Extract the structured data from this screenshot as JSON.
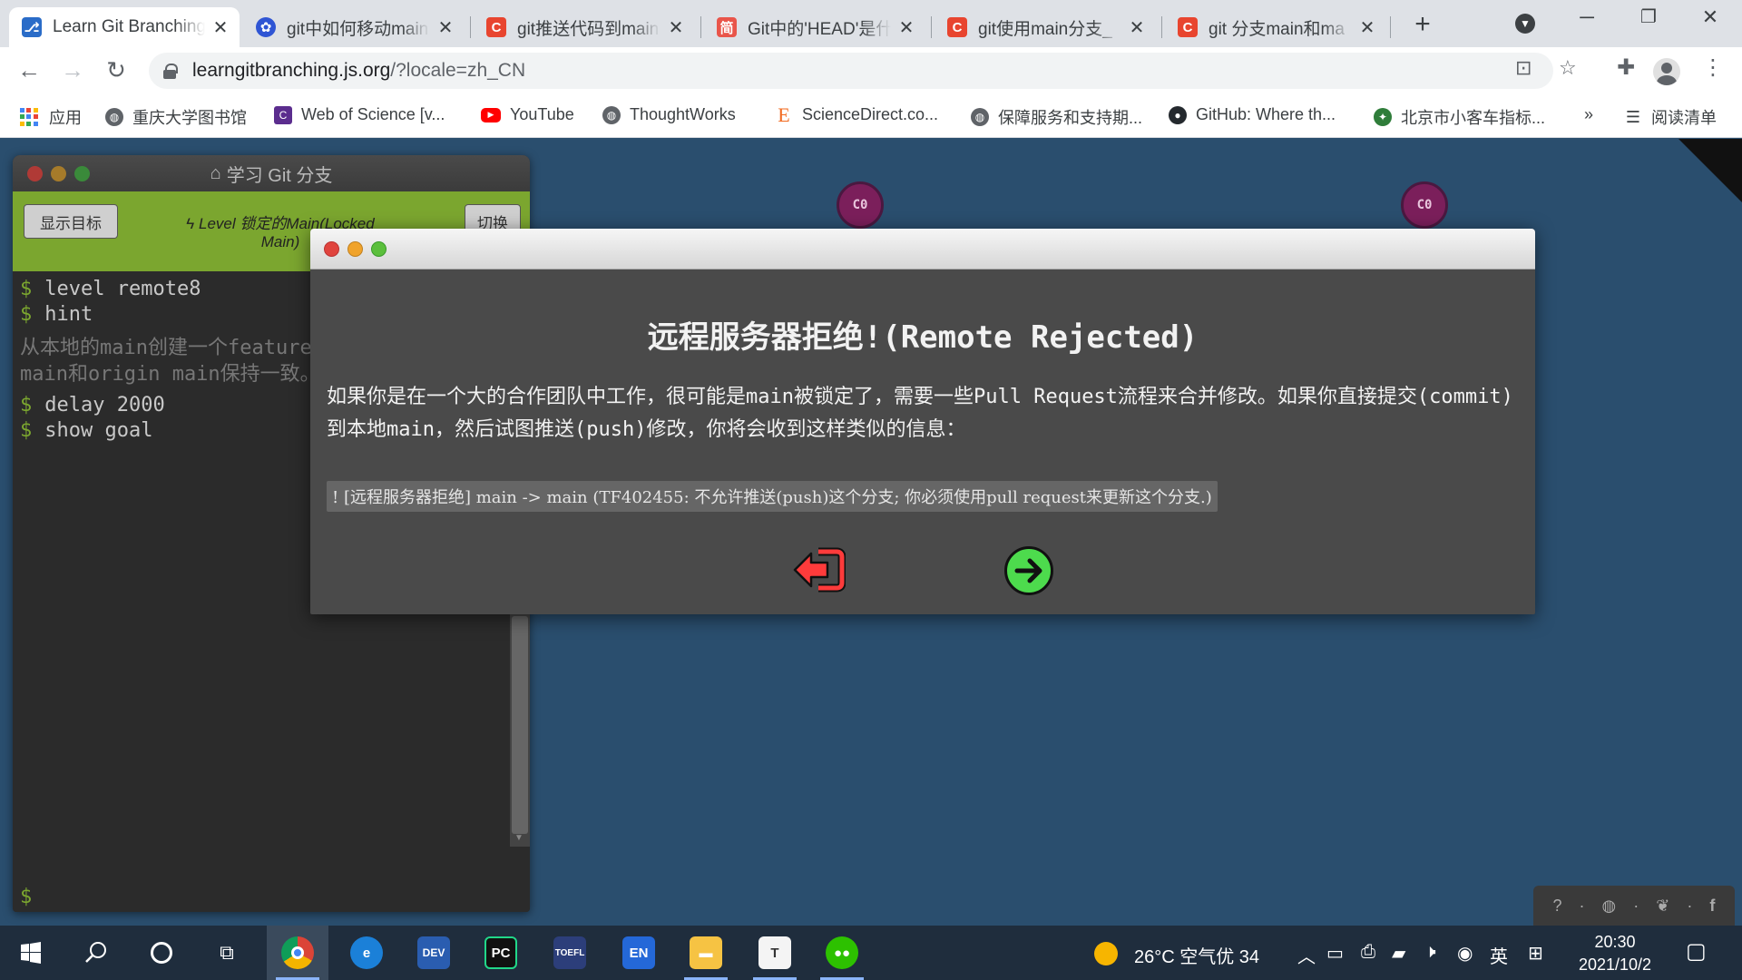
{
  "tabs": [
    {
      "title": "Learn Git Branching",
      "favicon": "git-tree-icon",
      "active": true
    },
    {
      "title": "git中如何移动main",
      "favicon": "baidu-paw-icon"
    },
    {
      "title": "git推送代码到main",
      "favicon": "csdn-icon"
    },
    {
      "title": "Git中的'HEAD'是什",
      "favicon": "jianshu-icon"
    },
    {
      "title": "git使用main分支_",
      "favicon": "csdn-icon"
    },
    {
      "title": "git 分支main和ma",
      "favicon": "csdn-icon"
    }
  ],
  "toolbar": {
    "url_host": "learngitbranching.js.org",
    "url_path": "/?locale=zh_CN"
  },
  "bookmarks": [
    {
      "label": "应用",
      "icon": "apps-icon"
    },
    {
      "label": "重庆大学图书馆",
      "icon": "globe-icon"
    },
    {
      "label": "Web of Science [v...",
      "icon": "wos-icon"
    },
    {
      "label": "YouTube",
      "icon": "youtube-icon"
    },
    {
      "label": "ThoughtWorks",
      "icon": "globe-icon"
    },
    {
      "label": "ScienceDirect.co...",
      "icon": "elsevier-icon"
    },
    {
      "label": "保障服务和支持期...",
      "icon": "globe-icon"
    },
    {
      "label": "GitHub: Where th...",
      "icon": "github-icon"
    },
    {
      "label": "北京市小客车指标...",
      "icon": "beijing-icon"
    }
  ],
  "bookmarks_more": "»",
  "reading_list": "阅读清单",
  "terminal": {
    "title": "学习 Git 分支",
    "goal_button": "显示目标",
    "level_label": "Level 锁定的Main(Locked Main)",
    "switch_button": "切换",
    "lines": [
      "level remote8",
      "hint"
    ],
    "hint": "从本地的main创建一个feature分支，并推送到远程。重置\nmain和origin main保持一致。",
    "lines2": [
      "delay 2000",
      "show goal"
    ],
    "prompt": "$"
  },
  "commits": [
    "C0",
    "C0"
  ],
  "modal": {
    "title": "远程服务器拒绝!(Remote Rejected)",
    "body": "如果你是在一个大的合作团队中工作，很可能是main被锁定了，需要一些Pull Request流程来合并修改。如果你直接提交(commit)到本地main，然后试图推送(push)修改，你将会收到这样类似的信息：",
    "code": "! [远程服务器拒绝] main -> main (TF402455: 不允许推送(push)这个分支; 你必须使用pull request来更新这个分支.)",
    "back_icon": "exit-icon",
    "next_icon": "arrow-right-icon"
  },
  "taskbar": {
    "weather": "26°C 空气优 34",
    "ime": "英",
    "time": "20:30",
    "date": "2021/10/2"
  }
}
